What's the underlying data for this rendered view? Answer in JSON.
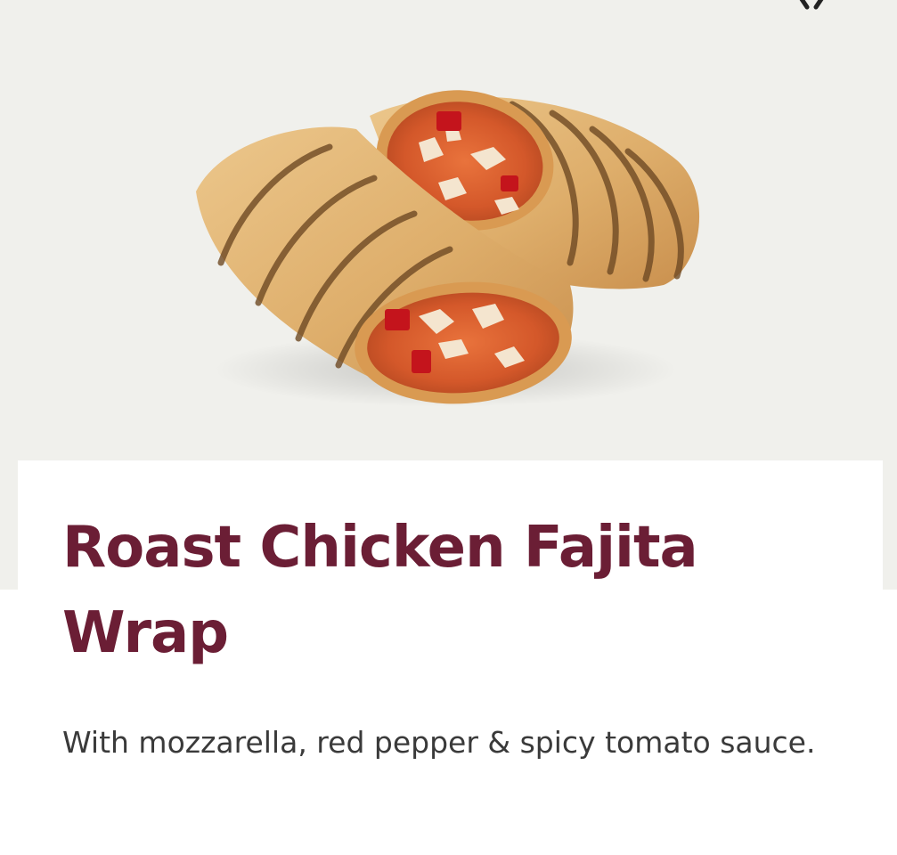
{
  "product": {
    "title": "Roast Chicken Fajita Wrap",
    "description": "With mozzarella, red pepper & spicy tomato sauce.",
    "image_alt": "Roast chicken fajita wrap cut in half"
  },
  "icons": {
    "close": "close-icon"
  },
  "colors": {
    "hero_background": "#f0f0ec",
    "card_background": "#ffffff",
    "title": "#6b1e35",
    "description": "#3a3a3a"
  }
}
